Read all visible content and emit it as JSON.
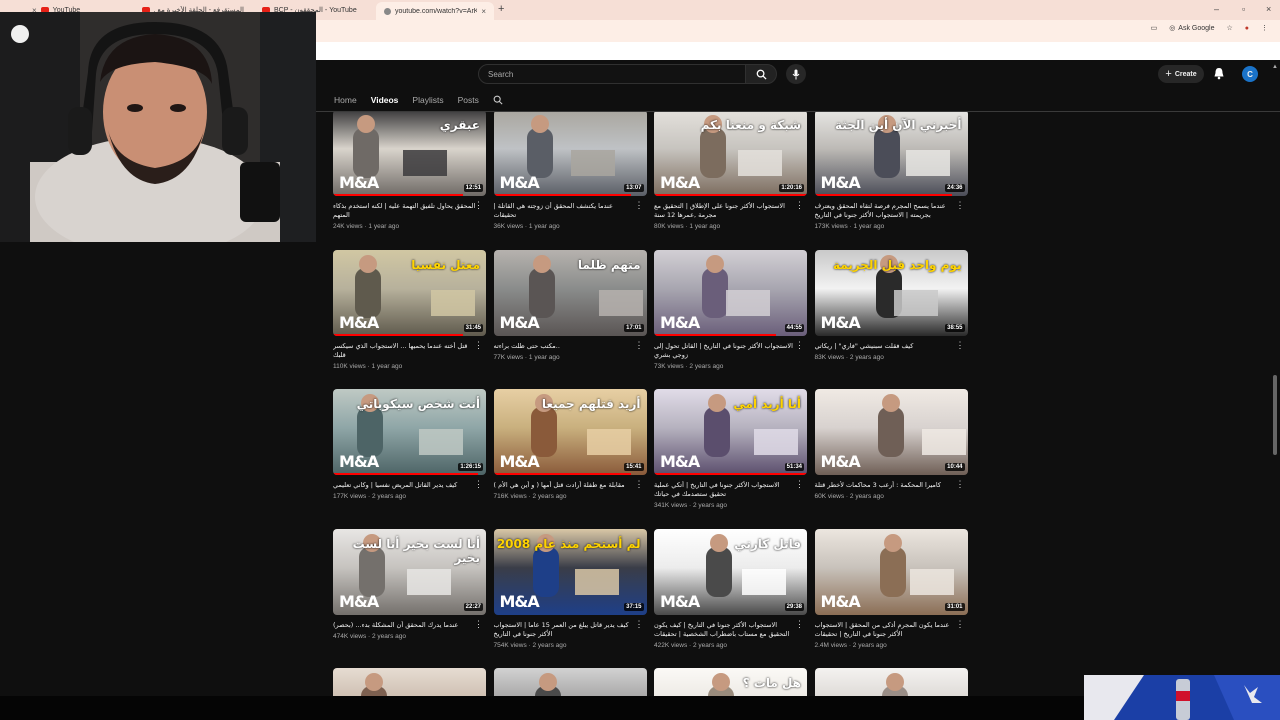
{
  "browser": {
    "tabs": [
      {
        "label": "YouTube"
      },
      {
        "label": "المستقرفع - الحلقة الأخيرة مع ..."
      },
      {
        "label": "BCP - المحققون - YouTube"
      },
      {
        "label": "youtube.com/watch?v=ArK9fy..."
      }
    ],
    "address": "youtube.com/watch?v=ArK9fy",
    "ask_google": "Ask Google"
  },
  "header": {
    "search_placeholder": "Search",
    "create_label": "Create",
    "avatar_letter": "C"
  },
  "channel_tabs": {
    "home": "Home",
    "videos": "Videos",
    "playlists": "Playlists",
    "posts": "Posts"
  },
  "colors": {
    "accent_red": "#ff0000",
    "page_bg": "#0f0f0f",
    "avatar_blue": "#1a73c9"
  },
  "videos": [
    {
      "title": "المحقق يحاول تلفيق التهمة عليه | لكنه استخدم بذكاء المتهم",
      "views": "24K views · 1 year ago",
      "duration": "12:51",
      "overlay": "عبقري",
      "progress": 0.85
    },
    {
      "title": "عندما يكتشف المحقق أن زوجته هي القاتلة | تحقيقات",
      "views": "36K views · 1 year ago",
      "duration": "13:07",
      "overlay": "",
      "progress": 0.9
    },
    {
      "title": "الاستجواب الأكثر جنونا على الإطلاق | التحقيق مع مجرمة ,عمرها 12 سنة",
      "views": "80K views · 1 year ago",
      "duration": "1:20:16",
      "overlay": "شبكة و منعنا بكم",
      "progress": 1.0
    },
    {
      "title": "عندما يسمح المجرم فرصة لتقاه المحقق ويعترف بجريمته | الاستجواب الأكثر جنونا في التاريخ",
      "views": "173K views · 1 year ago",
      "duration": "24:36",
      "overlay": "أخبرني الآن أين الجثة",
      "progress": 0.9
    },
    {
      "title": "قتل أخته عندما يحميها ... الاستجواب الذي سيكسر قلبك",
      "views": "110K views · 1 year ago",
      "duration": "31:45",
      "overlay": "معتل نفسيا",
      "progress": 0.85
    },
    {
      "title": "..مكتب حتى ظلت براءته",
      "views": "77K views · 1 year ago",
      "duration": "17:01",
      "overlay": "متهم ظلما",
      "progress": 0.0
    },
    {
      "title": "الاستجواب الأكثر جنونا في التاريخ | القاتل تحول إلى زوجي بشري",
      "views": "73K views · 2 years ago",
      "duration": "44:55",
      "overlay": "",
      "progress": 0.8
    },
    {
      "title": "كيف فقلت سبنيشي \"فاري\" | ريكاتي",
      "views": "83K views · 2 years ago",
      "duration": "38:55",
      "overlay": "يوم واحد قبل الجريمة",
      "progress": 0.0
    },
    {
      "title": "كيف يدير القاتل المريض نفسيا | وكاني تعليمي",
      "views": "177K views · 2 years ago",
      "duration": "1:26:15",
      "overlay": "أنت شخص سيكوباتي",
      "progress": 0.95
    },
    {
      "title": "مقابلة مع طفلة أرادت قتل أمها ( و أين هي الأم )",
      "views": "716K views · 2 years ago",
      "duration": "15:41",
      "overlay": "أريد قتلهم جميعا",
      "progress": 0.9
    },
    {
      "title": "الاستجواب الأكثر جنونا في التاريخ | أتكي عملية تحقيق ستصدمك في حياتك",
      "views": "341K views · 2 years ago",
      "duration": "51:34",
      "overlay": "أنا أريد أمي",
      "progress": 1.0
    },
    {
      "title": "كاميرا المحكمة : أرعب 3 محاكمات لأخطر قتلة",
      "views": "60K views · 2 years ago",
      "duration": "10:44",
      "overlay": "",
      "progress": 0.0
    },
    {
      "title": "عندما يدرك المحقق أن المشكلة بدء... (بحصر)",
      "views": "474K views · 2 years ago",
      "duration": "22:27",
      "overlay": "أنا لست بخير أنا لست بخير",
      "progress": 0.0
    },
    {
      "title": "كيف يدير قاتل يبلغ من العمر 15 عاما | الاستجواب الأكثر جنونا في التاريخ",
      "views": "754K views · 2 years ago",
      "duration": "37:15",
      "overlay": "لم أستحم منذ عام 2008",
      "progress": 0.0
    },
    {
      "title": "الاستجواب الأكثر جنونا في التاريخ | كيف يكون التحقيق مع مستاب باضطراب الشخصية | تحقيقات",
      "views": "422K views · 2 years ago",
      "duration": "29:38",
      "overlay": "قاتل كارتي",
      "progress": 0.0
    },
    {
      "title": "عندما يكون المجرم أذكى من المحقق | الاستجواب الأكثر جنونا في التاريخ | تحقيقات",
      "views": "2.4M views · 2 years ago",
      "duration": "31:01",
      "overlay": "",
      "progress": 0.0
    },
    {
      "title": "",
      "views": "",
      "duration": "",
      "overlay": "",
      "progress": 0.0
    },
    {
      "title": "",
      "views": "",
      "duration": "",
      "overlay": "",
      "progress": 0.0
    },
    {
      "title": "",
      "views": "",
      "duration": "",
      "overlay": "هل مات ؟",
      "progress": 0.0
    },
    {
      "title": "",
      "views": "",
      "duration": "",
      "overlay": "",
      "progress": 0.0
    }
  ]
}
